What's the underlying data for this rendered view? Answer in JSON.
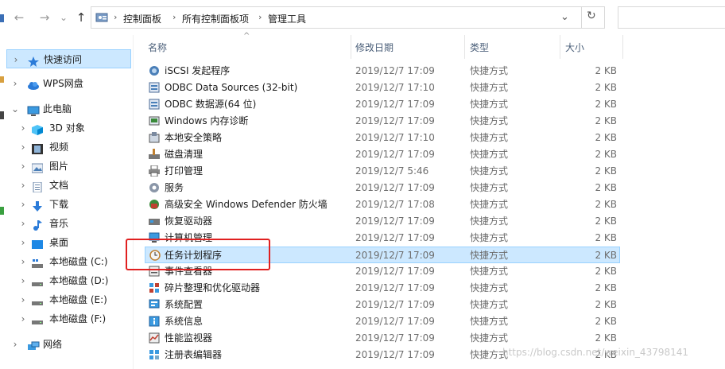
{
  "toolbar": {
    "back": "←",
    "forward": "→",
    "recent": "⌄",
    "up": "↑",
    "dropdown": "⌄",
    "refresh": "↻"
  },
  "address": {
    "crumbs": [
      "控制面板",
      "所有控制面板项",
      "管理工具"
    ],
    "separator": "›"
  },
  "sidebar": {
    "items": [
      {
        "label": "快速访问",
        "icon": "star-icon"
      },
      {
        "label": "WPS网盘",
        "icon": "cloud-icon"
      },
      {
        "label": "此电脑",
        "icon": "computer-icon"
      },
      {
        "label": "3D 对象",
        "icon": "cube-icon"
      },
      {
        "label": "视频",
        "icon": "film-icon"
      },
      {
        "label": "图片",
        "icon": "picture-icon"
      },
      {
        "label": "文档",
        "icon": "document-icon"
      },
      {
        "label": "下载",
        "icon": "download-icon"
      },
      {
        "label": "音乐",
        "icon": "music-icon"
      },
      {
        "label": "桌面",
        "icon": "desktop-icon"
      },
      {
        "label": "本地磁盘 (C:)",
        "icon": "drive-icon"
      },
      {
        "label": "本地磁盘 (D:)",
        "icon": "drive-icon"
      },
      {
        "label": "本地磁盘 (E:)",
        "icon": "drive-icon"
      },
      {
        "label": "本地磁盘 (F:)",
        "icon": "drive-icon"
      },
      {
        "label": "网络",
        "icon": "network-icon"
      }
    ]
  },
  "columns": {
    "name": "名称",
    "date": "修改日期",
    "type": "类型",
    "size": "大小",
    "sort_indicator": "^"
  },
  "files": [
    {
      "name": "iSCSI 发起程序",
      "date": "2019/12/7 17:09",
      "type": "快捷方式",
      "size": "2 KB"
    },
    {
      "name": "ODBC Data Sources (32-bit)",
      "date": "2019/12/7 17:10",
      "type": "快捷方式",
      "size": "2 KB"
    },
    {
      "name": "ODBC 数据源(64 位)",
      "date": "2019/12/7 17:09",
      "type": "快捷方式",
      "size": "2 KB"
    },
    {
      "name": "Windows 内存诊断",
      "date": "2019/12/7 17:09",
      "type": "快捷方式",
      "size": "2 KB"
    },
    {
      "name": "本地安全策略",
      "date": "2019/12/7 17:10",
      "type": "快捷方式",
      "size": "2 KB"
    },
    {
      "name": "磁盘清理",
      "date": "2019/12/7 17:09",
      "type": "快捷方式",
      "size": "2 KB"
    },
    {
      "name": "打印管理",
      "date": "2019/12/7 5:46",
      "type": "快捷方式",
      "size": "2 KB"
    },
    {
      "name": "服务",
      "date": "2019/12/7 17:09",
      "type": "快捷方式",
      "size": "2 KB"
    },
    {
      "name": "高级安全 Windows Defender 防火墙",
      "date": "2019/12/7 17:08",
      "type": "快捷方式",
      "size": "2 KB"
    },
    {
      "name": "恢复驱动器",
      "date": "2019/12/7 17:09",
      "type": "快捷方式",
      "size": "2 KB"
    },
    {
      "name": "计算机管理",
      "date": "2019/12/7 17:09",
      "type": "快捷方式",
      "size": "2 KB"
    },
    {
      "name": "任务计划程序",
      "date": "2019/12/7 17:09",
      "type": "快捷方式",
      "size": "2 KB"
    },
    {
      "name": "事件查看器",
      "date": "2019/12/7 17:09",
      "type": "快捷方式",
      "size": "2 KB"
    },
    {
      "name": "碎片整理和优化驱动器",
      "date": "2019/12/7 17:09",
      "type": "快捷方式",
      "size": "2 KB"
    },
    {
      "name": "系统配置",
      "date": "2019/12/7 17:09",
      "type": "快捷方式",
      "size": "2 KB"
    },
    {
      "name": "系统信息",
      "date": "2019/12/7 17:09",
      "type": "快捷方式",
      "size": "2 KB"
    },
    {
      "name": "性能监视器",
      "date": "2019/12/7 17:09",
      "type": "快捷方式",
      "size": "2 KB"
    },
    {
      "name": "注册表编辑器",
      "date": "2019/12/7 17:09",
      "type": "快捷方式",
      "size": "2 KB"
    }
  ],
  "watermark": "https://blog.csdn.net/weixin_43798141",
  "colors": {
    "selection": "#cce8ff",
    "selection_border": "#99d1ff",
    "highlight_box": "#e02020"
  }
}
